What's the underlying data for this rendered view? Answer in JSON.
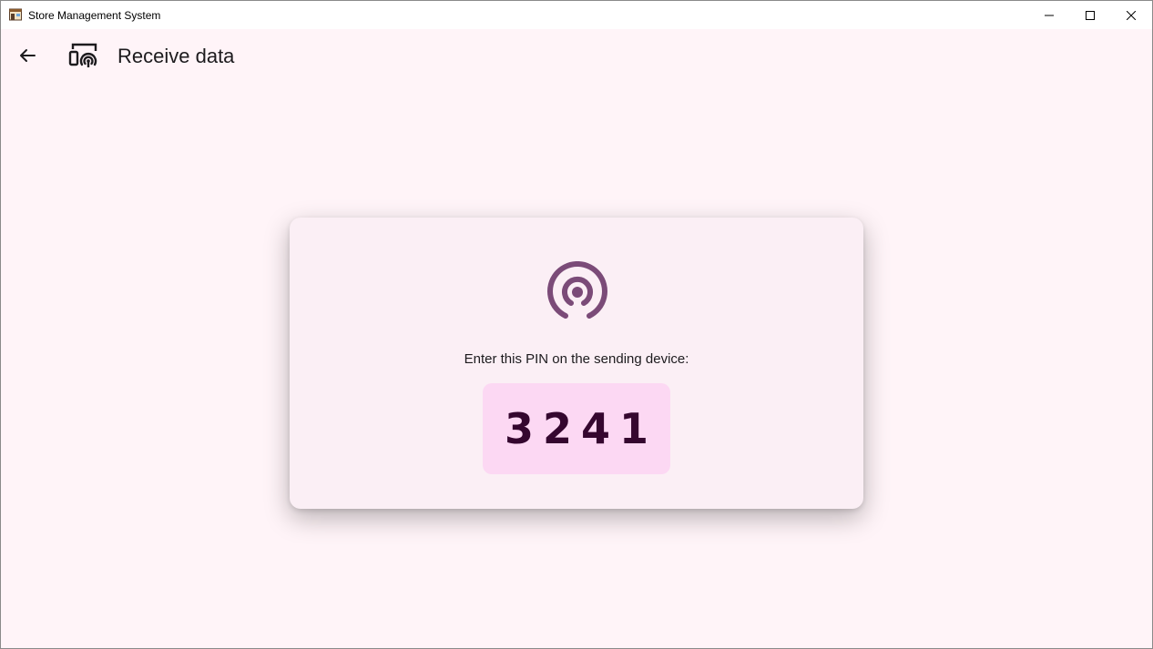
{
  "window": {
    "title": "Store Management System",
    "controls": {
      "minimize_icon": "minimize-icon",
      "maximize_icon": "maximize-icon",
      "close_icon": "close-icon"
    }
  },
  "appbar": {
    "back_icon": "arrow-back-icon",
    "header_icon": "devices-wifi-icon",
    "title": "Receive data"
  },
  "card": {
    "icon": "broadcast-icon",
    "instruction": "Enter this PIN on the sending device:",
    "pin": "3241"
  },
  "colors": {
    "background": "#fff4f8",
    "card_background": "#fbeff5",
    "pin_background": "#fcd8f3",
    "pin_text": "#35072f",
    "accent_icon": "#7b4b78"
  }
}
